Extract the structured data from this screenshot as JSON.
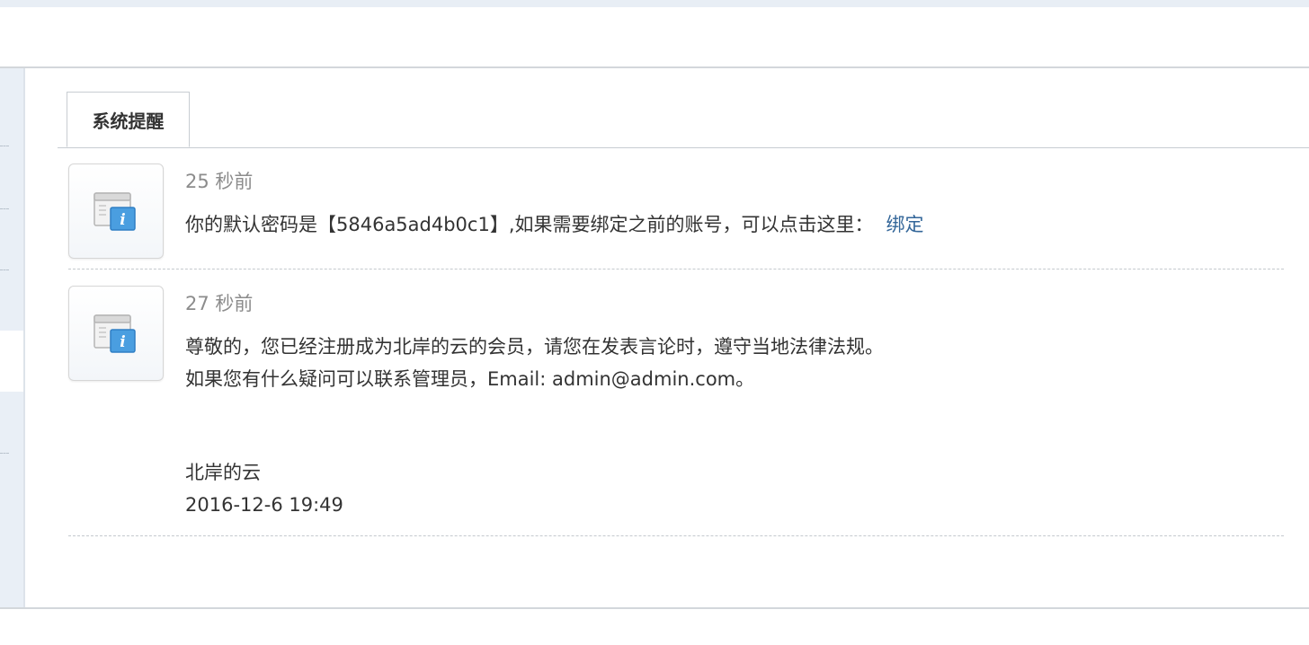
{
  "tabs": [
    {
      "label": "系统提醒",
      "active": true
    }
  ],
  "notifications": [
    {
      "time": "25 秒前",
      "icon": "info-window-icon",
      "text": "你的默认密码是【5846a5ad4b0c1】,如果需要绑定之前的账号，可以点击这里：",
      "link_label": "绑定"
    },
    {
      "time": "27 秒前",
      "icon": "info-window-icon",
      "lines": [
        "尊敬的，您已经注册成为北岸的云的会员，请您在发表言论时，遵守当地法律法规。",
        "如果您有什么疑问可以联系管理员，Email: admin@admin.com。"
      ],
      "signature": "北岸的云",
      "signature_date": "2016-12-6 19:49"
    }
  ],
  "colors": {
    "link": "#336699",
    "time_text": "#8c8c8c",
    "body_text": "#333333",
    "sidebar_bg": "#e9eff6"
  }
}
